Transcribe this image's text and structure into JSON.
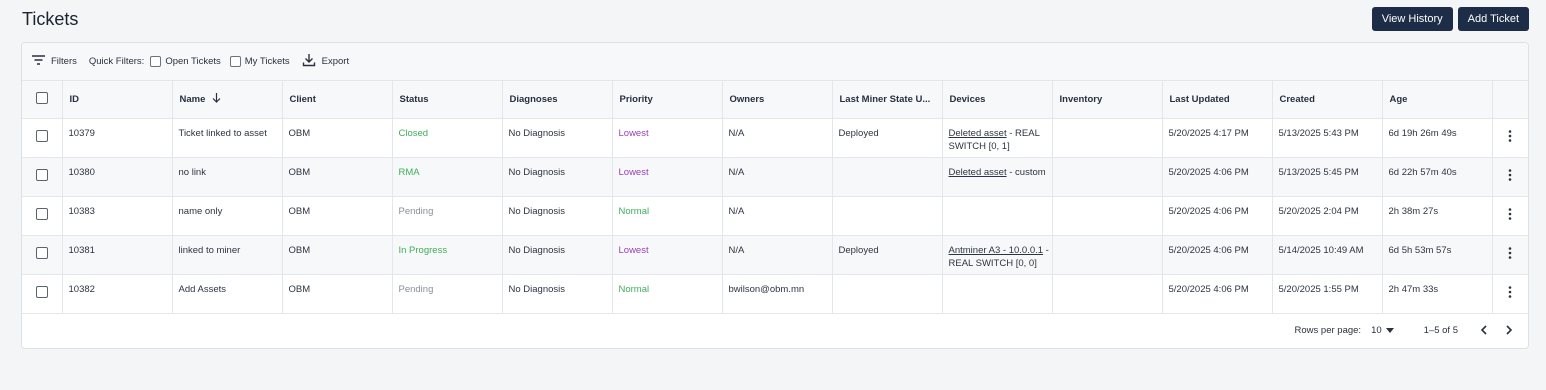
{
  "page": {
    "title": "Tickets"
  },
  "actions": {
    "view_history": "View History",
    "add_ticket": "Add Ticket"
  },
  "toolbar": {
    "filters_label": "Filters",
    "quick_filters_label": "Quick Filters:",
    "open_tickets_label": "Open Tickets",
    "my_tickets_label": "My Tickets",
    "export_label": "Export"
  },
  "colors": {
    "closed": "#3fae5a",
    "rma": "#3fae5a",
    "in_progress": "#3fae5a",
    "pending": "#8a9099",
    "lowest": "#9b3fb5",
    "normal": "#3fae5a"
  },
  "table": {
    "headers": {
      "id": "ID",
      "name": "Name",
      "client": "Client",
      "status": "Status",
      "diagnoses": "Diagnoses",
      "priority": "Priority",
      "owners": "Owners",
      "last_miner_state": "Last Miner State U...",
      "devices": "Devices",
      "inventory": "Inventory",
      "last_updated": "Last Updated",
      "created": "Created",
      "age": "Age"
    },
    "rows": [
      {
        "id": "10379",
        "name": "Ticket linked to asset",
        "client": "OBM",
        "status": "Closed",
        "status_key": "closed",
        "diagnoses": "No Diagnosis",
        "priority": "Lowest",
        "priority_key": "lowest",
        "owners": "N/A",
        "last_miner_state": "Deployed",
        "device_link": "Deleted asset",
        "device_rest": " - REAL SWITCH [0, 1]",
        "inventory": "",
        "last_updated": "5/20/2025 4:17 PM",
        "created": "5/13/2025 5:43 PM",
        "age": "6d 19h 26m 49s"
      },
      {
        "id": "10380",
        "name": "no link",
        "client": "OBM",
        "status": "RMA",
        "status_key": "rma",
        "diagnoses": "No Diagnosis",
        "priority": "Lowest",
        "priority_key": "lowest",
        "owners": "N/A",
        "last_miner_state": "",
        "device_link": "Deleted asset",
        "device_rest": " - custom",
        "inventory": "",
        "last_updated": "5/20/2025 4:06 PM",
        "created": "5/13/2025 5:45 PM",
        "age": "6d 22h 57m 40s"
      },
      {
        "id": "10383",
        "name": "name only",
        "client": "OBM",
        "status": "Pending",
        "status_key": "pending",
        "diagnoses": "No Diagnosis",
        "priority": "Normal",
        "priority_key": "normal",
        "owners": "N/A",
        "last_miner_state": "",
        "device_link": "",
        "device_rest": "",
        "inventory": "",
        "last_updated": "5/20/2025 4:06 PM",
        "created": "5/20/2025 2:04 PM",
        "age": "2h 38m 27s"
      },
      {
        "id": "10381",
        "name": "linked to miner",
        "client": "OBM",
        "status": "In Progress",
        "status_key": "in_progress",
        "diagnoses": "No Diagnosis",
        "priority": "Lowest",
        "priority_key": "lowest",
        "owners": "N/A",
        "last_miner_state": "Deployed",
        "device_link": "Antminer A3 - 10.0.0.1",
        "device_rest": " - REAL SWITCH [0, 0]",
        "inventory": "",
        "last_updated": "5/20/2025 4:06 PM",
        "created": "5/14/2025 10:49 AM",
        "age": "6d 5h 53m 57s"
      },
      {
        "id": "10382",
        "name": "Add Assets",
        "client": "OBM",
        "status": "Pending",
        "status_key": "pending",
        "diagnoses": "No Diagnosis",
        "priority": "Normal",
        "priority_key": "normal",
        "owners": "bwilson@obm.mn",
        "last_miner_state": "",
        "device_link": "",
        "device_rest": "",
        "inventory": "",
        "last_updated": "5/20/2025 4:06 PM",
        "created": "5/20/2025 1:55 PM",
        "age": "2h 47m 33s"
      }
    ]
  },
  "footer": {
    "rows_per_page_label": "Rows per page:",
    "rows_per_page_value": "10",
    "range_label": "1–5 of 5"
  }
}
